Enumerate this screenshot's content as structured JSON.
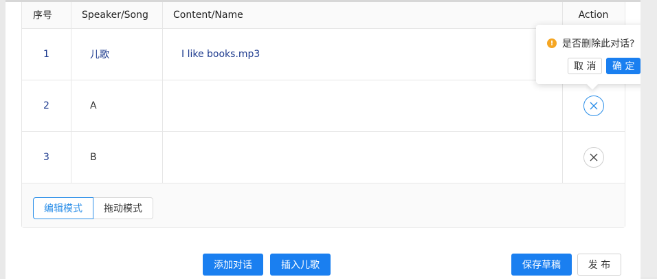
{
  "table": {
    "headers": {
      "no": "序号",
      "speaker": "Speaker/Song",
      "content": "Content/Name",
      "action": "Action"
    },
    "rows": [
      {
        "no": "1",
        "speaker": "儿歌",
        "content": "I like books.mp3"
      },
      {
        "no": "2",
        "speaker": "A",
        "content": ""
      },
      {
        "no": "3",
        "speaker": "B",
        "content": ""
      }
    ]
  },
  "modes": {
    "edit": "编辑模式",
    "drag": "拖动模式"
  },
  "popconfirm": {
    "message": "是否删除此对话?",
    "cancel": "取 消",
    "ok": "确 定"
  },
  "actions": {
    "add_dialog": "添加对话",
    "insert_song": "插入儿歌",
    "save_draft": "保存草稿",
    "publish": "发 布"
  },
  "colors": {
    "primary": "#1a7ff0",
    "warning": "#f5a623",
    "text_blue": "#1f3c8f"
  },
  "icons": {
    "delete": "close-icon",
    "warning": "exclamation-icon"
  }
}
